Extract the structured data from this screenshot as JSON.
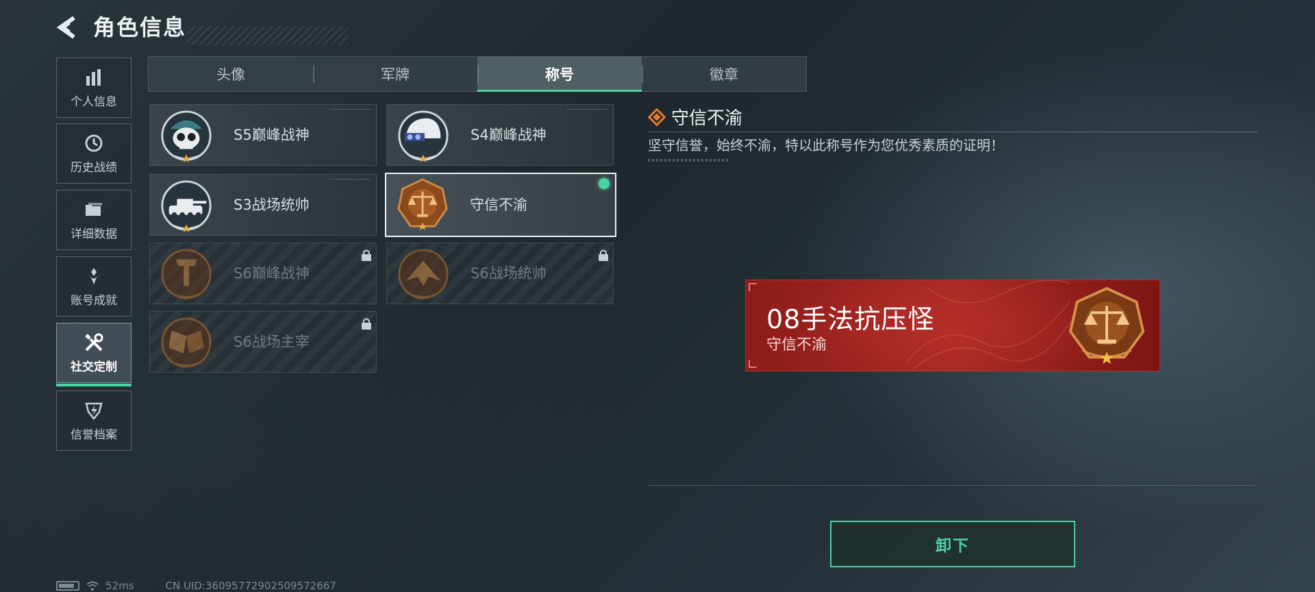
{
  "header": {
    "title": "角色信息"
  },
  "sidebar": {
    "items": [
      {
        "label": "个人信息",
        "icon": "bar-chart-icon"
      },
      {
        "label": "历史战绩",
        "icon": "history-clock-icon"
      },
      {
        "label": "详细数据",
        "icon": "folder-icon"
      },
      {
        "label": "账号成就",
        "icon": "achievement-icon"
      },
      {
        "label": "社交定制",
        "icon": "tools-icon",
        "active": true
      },
      {
        "label": "信誉档案",
        "icon": "reputation-shield-icon"
      }
    ]
  },
  "tabs": [
    {
      "label": "头像"
    },
    {
      "label": "军牌"
    },
    {
      "label": "称号",
      "active": true
    },
    {
      "label": "徽章"
    }
  ],
  "titles": [
    {
      "label": "S5巅峰战神",
      "locked": false,
      "emblem": "skull-helmet-emblem"
    },
    {
      "label": "S4巅峰战神",
      "locked": false,
      "emblem": "helmet-emblem"
    },
    {
      "label": "S3战场统帅",
      "locked": false,
      "emblem": "tank-emblem"
    },
    {
      "label": "守信不渝",
      "locked": false,
      "selected": true,
      "equipped": true,
      "emblem": "scales-emblem"
    },
    {
      "label": "S6巅峰战神",
      "locked": true,
      "emblem": "t-shield-emblem"
    },
    {
      "label": "S6战场统帅",
      "locked": true,
      "emblem": "jet-emblem"
    },
    {
      "label": "S6战场主宰",
      "locked": true,
      "emblem": "flags-emblem"
    }
  ],
  "detail": {
    "name": "守信不渝",
    "description": "坚守信誉，始终不渝，特以此称号作为您优秀素质的证明！"
  },
  "preview": {
    "player_name": "08手法抗压怪",
    "title": "守信不渝"
  },
  "actions": {
    "unequip_label": "卸下"
  },
  "status": {
    "ping": "52ms",
    "uid": "CN UID:36095772902509572667"
  },
  "colors": {
    "accent": "#4bd4a3",
    "banner_red": "#a52823",
    "emblem_bronze": "#b5702f"
  }
}
